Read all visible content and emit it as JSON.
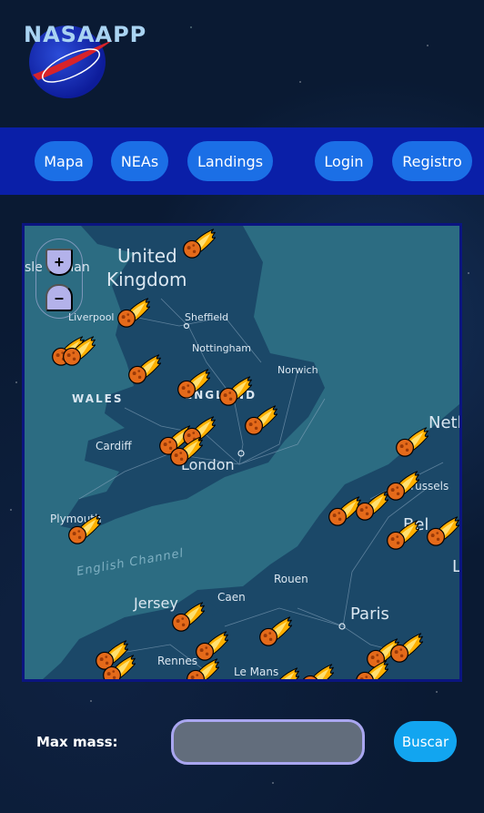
{
  "app": {
    "title": "NASAAPP",
    "logo_icon": "nasa-meatball-icon"
  },
  "nav": {
    "items": [
      {
        "label": "Mapa"
      },
      {
        "label": "NEAs"
      },
      {
        "label": "Landings"
      },
      {
        "label": "Login"
      },
      {
        "label": "Registro"
      }
    ]
  },
  "map": {
    "zoom_in": "+",
    "zoom_out": "–",
    "marker_icon": "flaming-meteorite-icon",
    "labels": {
      "isle_of_man": "sle of Man",
      "united": "United",
      "kingdom": "Kingdom",
      "liverpool": "Liverpool",
      "sheffield": "Sheffield",
      "nottingham": "Nottingham",
      "norwich": "Norwich",
      "wales": "WALES",
      "england": "ENGLAND",
      "cardiff": "Cardiff",
      "london": "London",
      "plymouth": "Plymouth",
      "channel": "English Channel",
      "netherlands": "Neth",
      "brussels": "Brussels",
      "belgium": "Bel",
      "jersey": "Jersey",
      "caen": "Caen",
      "rouen": "Rouen",
      "paris": "Paris",
      "rennes": "Rennes",
      "le_mans": "Le Mans",
      "l": "L"
    },
    "colors": {
      "water": "#2c6c82",
      "land": "#1b4868",
      "roads": "#8aa7bf"
    }
  },
  "search": {
    "label": "Max mass:",
    "value": "",
    "placeholder": "",
    "button": "Buscar"
  }
}
